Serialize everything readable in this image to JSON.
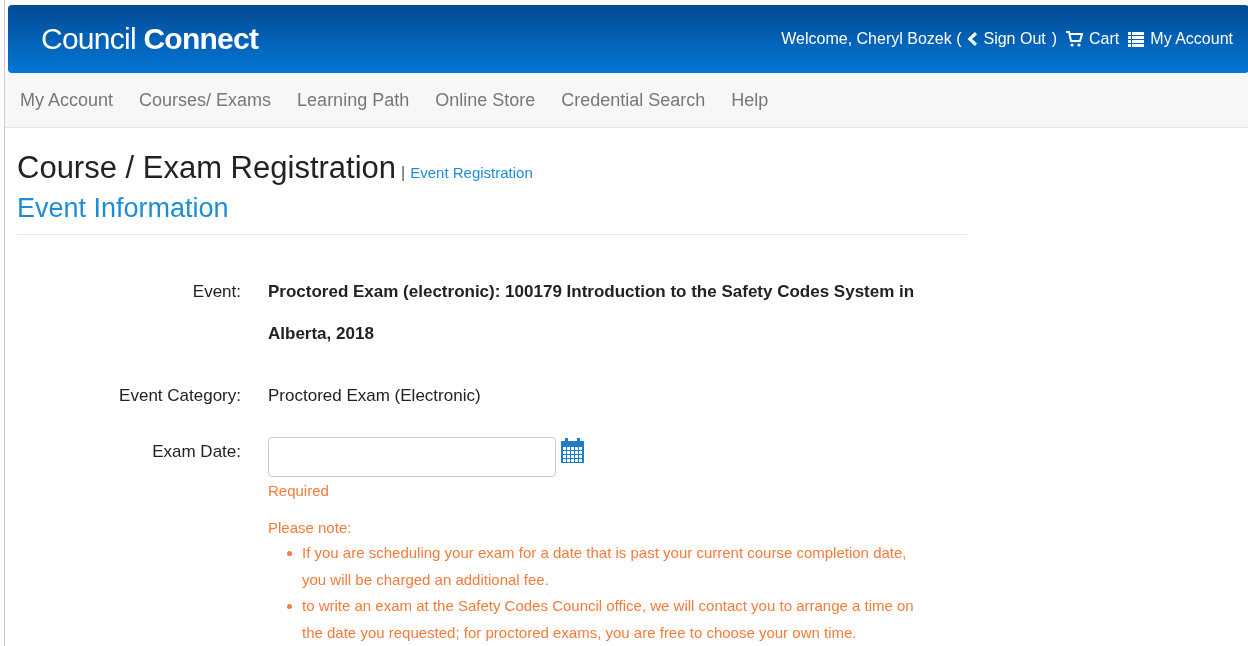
{
  "header": {
    "logo": {
      "light": "Council",
      "bold": "Connect"
    },
    "welcome": "Welcome, Cheryl Bozek (",
    "sign_out": "Sign Out",
    "sign_out_close": ")",
    "cart": "Cart",
    "account": "My Account"
  },
  "nav": [
    "My Account",
    "Courses/ Exams",
    "Learning Path",
    "Online Store",
    "Credential Search",
    "Help"
  ],
  "page": {
    "title": "Course / Exam Registration",
    "separator": "|",
    "breadcrumb": "Event Registration",
    "section": "Event Information"
  },
  "fields": [
    {
      "kind": "bold",
      "label": "Event:",
      "value": "Proctored Exam (electronic): 100179 Introduction to the Safety Codes System in Alberta, 2018"
    },
    {
      "kind": "text",
      "label": "Event Category:",
      "value": "Proctored Exam (Electronic)"
    },
    {
      "kind": "date",
      "label": "Exam Date:",
      "error": "Required",
      "note_title": "Please note:",
      "notes": [
        "If you are scheduling your exam for a date that is past your current course completion date, you will be charged an additional fee.",
        "to write an exam at the Safety Codes Council office, we will contact you to arrange a time on the date you requested; for proctored exams, you are free to choose your own time."
      ]
    }
  ]
}
